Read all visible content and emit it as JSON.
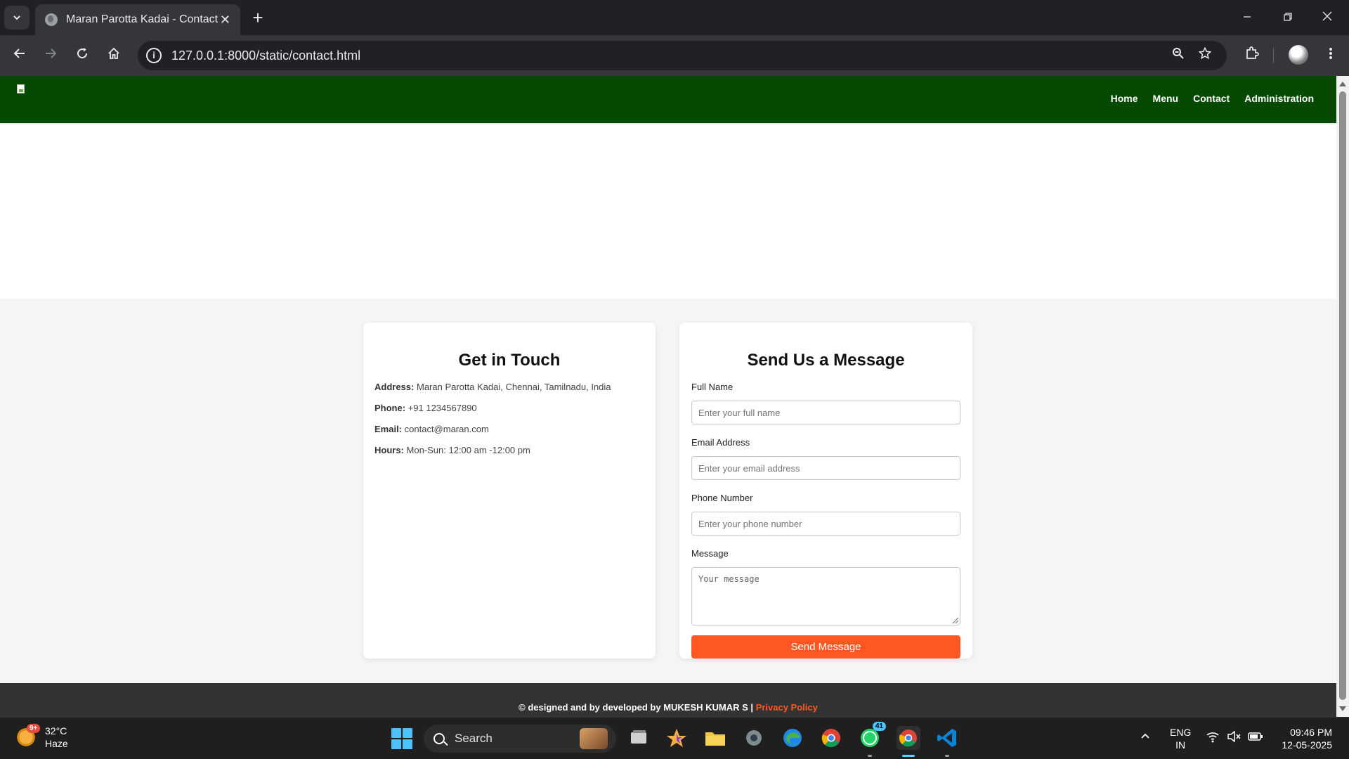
{
  "browser": {
    "tab_title": "Maran Parotta Kadai - Contact Us",
    "url": "127.0.0.1:8000/static/contact.html",
    "new_tab_symbol": "+",
    "close_symbol": "✕"
  },
  "site": {
    "nav": [
      "Home",
      "Menu",
      "Contact",
      "Administration"
    ],
    "header_color": "#054a00",
    "accent_color": "#ff5722"
  },
  "info_card": {
    "heading": "Get in Touch",
    "rows": [
      {
        "label": "Address:",
        "value": "Maran Parotta Kadai, Chennai, Tamilnadu, India"
      },
      {
        "label": "Phone:",
        "value": "+91 1234567890"
      },
      {
        "label": "Email:",
        "value": "contact@maran.com"
      },
      {
        "label": "Hours:",
        "value": "Mon-Sun: 12:00 am -12:00 pm"
      }
    ]
  },
  "form_card": {
    "heading": "Send Us a Message",
    "fields": [
      {
        "label": "Full Name",
        "placeholder": "Enter your full name"
      },
      {
        "label": "Email Address",
        "placeholder": "Enter your email address"
      },
      {
        "label": "Phone Number",
        "placeholder": "Enter your phone number"
      }
    ],
    "message_label": "Message",
    "message_placeholder": "Your message",
    "submit_label": "Send Message"
  },
  "footer": {
    "text": "© designed and by developed by MUKESH KUMAR S | ",
    "privacy_link": "Privacy Policy"
  },
  "taskbar": {
    "weather_temp": "32°C",
    "weather_desc": "Haze",
    "weather_badge": "9+",
    "search_label": "Search",
    "whatsapp_badge": "41",
    "lang_line1": "ENG",
    "lang_line2": "IN",
    "time": "09:46 PM",
    "date": "12-05-2025"
  }
}
